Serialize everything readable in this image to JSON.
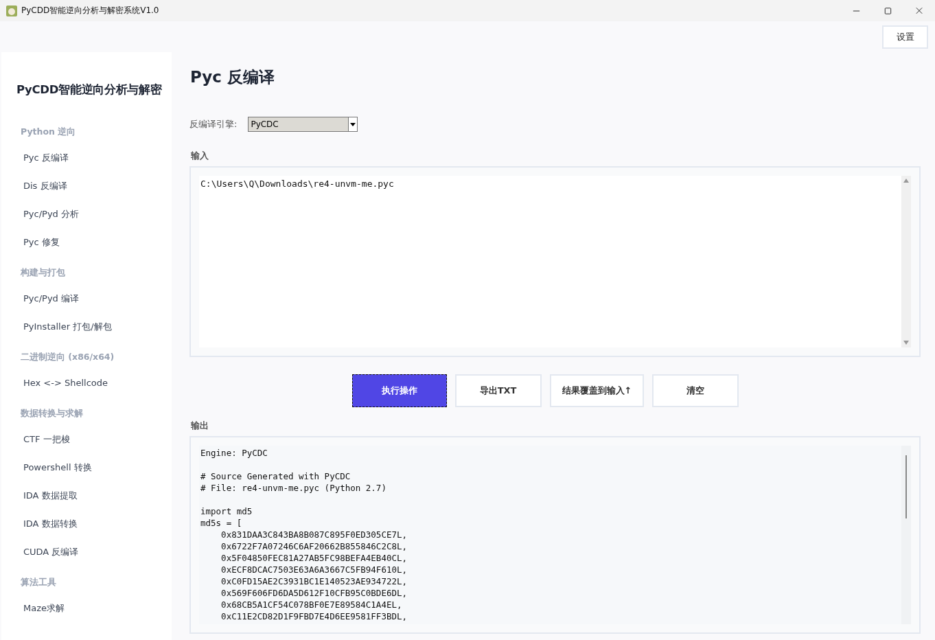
{
  "window": {
    "title": "PyCDD智能逆向分析与解密系统V1.0"
  },
  "settings_button": "设置",
  "sidebar": {
    "title": "PyCDD智能逆向分析与解密",
    "groups": [
      {
        "heading": "Python 逆向",
        "items": [
          "Pyc 反编译",
          "Dis 反编译",
          "Pyc/Pyd 分析",
          "Pyc 修复"
        ]
      },
      {
        "heading": "构建与打包",
        "items": [
          "Pyc/Pyd 编译",
          "PyInstaller 打包/解包"
        ]
      },
      {
        "heading": "二进制逆向 (x86/x64)",
        "items": [
          "Hex <-> Shellcode"
        ]
      },
      {
        "heading": "数据转换与求解",
        "items": [
          "CTF 一把梭",
          "Powershell 转换",
          "IDA 数据提取",
          "IDA 数据转换",
          "CUDA 反编译"
        ]
      },
      {
        "heading": "算法工具",
        "items": [
          "Maze求解"
        ]
      }
    ]
  },
  "page": {
    "title": "Pyc 反编译",
    "engine_label": "反编译引擎:",
    "engine": "PyCDC",
    "input_label": "输入",
    "input": "C:\\Users\\Q\\Downloads\\re4-unvm-me.pyc",
    "buttons": [
      {
        "label": "执行操作",
        "kind": "primary"
      },
      {
        "label": "导出TXT",
        "kind": "normal"
      },
      {
        "label": "结果覆盖到输入↑",
        "kind": "normal"
      },
      {
        "label": "清空",
        "kind": "normal"
      }
    ],
    "output_label": "输出",
    "output": [
      [
        "Engine: PyCDC"
      ],
      [
        "# Source Generated with PyCDC",
        "# File: re4-unvm-me.pyc (Python 2.7)"
      ],
      [
        "import md5",
        "md5s = [",
        "    0x831DAA3C843BA8B087C895F0ED305CE7L,",
        "    0x6722F7A07246C6AF20662B855846C2C8L,",
        "    0x5F04850FEC81A27AB5FC98BEFA4EB40CL,",
        "    0xECF8DCAC7503E63A6A3667C5FB94F610L,",
        "    0xC0FD15AE2C3931BC1E140523AE934722L,",
        "    0x569F606FD6DA5D612F10CFB95C0BDE6DL,",
        "    0x68CB5A1CF54C078BF0E7E89584C1A4EL,",
        "    0xC11E2CD82D1F9FBD7E4D6EE9581FF3BDL,"
      ]
    ]
  }
}
